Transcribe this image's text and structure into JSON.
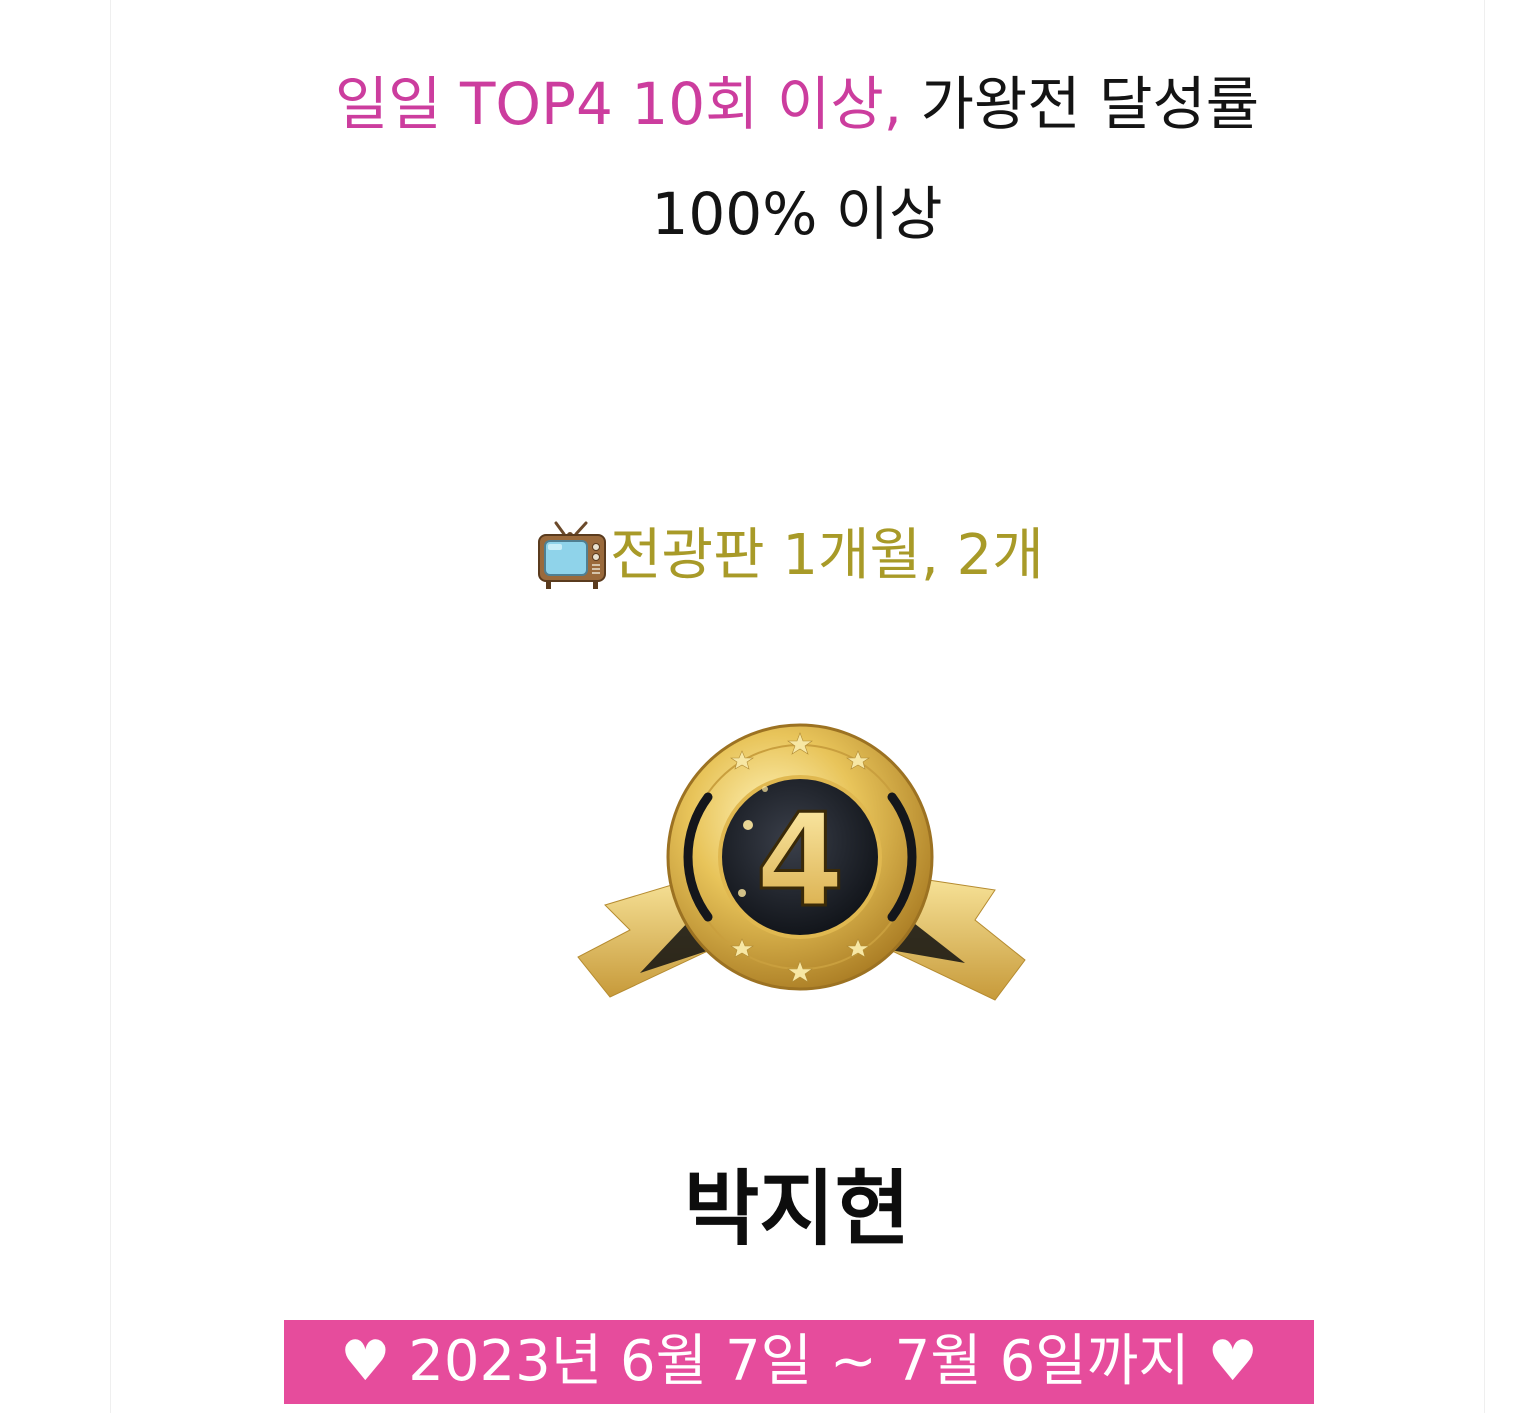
{
  "headline": {
    "highlight": "일일 TOP4 10회 이상,",
    "rest": "가왕전 달성률",
    "line2": "100% 이상"
  },
  "billboard": {
    "icon": "tv-icon",
    "text": "전광판 1개월, 2개"
  },
  "medal": {
    "icon": "rank-medal-icon",
    "number": "4"
  },
  "name": "박지현",
  "date_range": "♥ 2023년 6월 7일 ~ 7월 6일까지 ♥",
  "colors": {
    "highlight": "#cc3d9e",
    "billboard_text": "#a89a28",
    "band": "#e64c9c",
    "gold": "#e8c45a"
  }
}
